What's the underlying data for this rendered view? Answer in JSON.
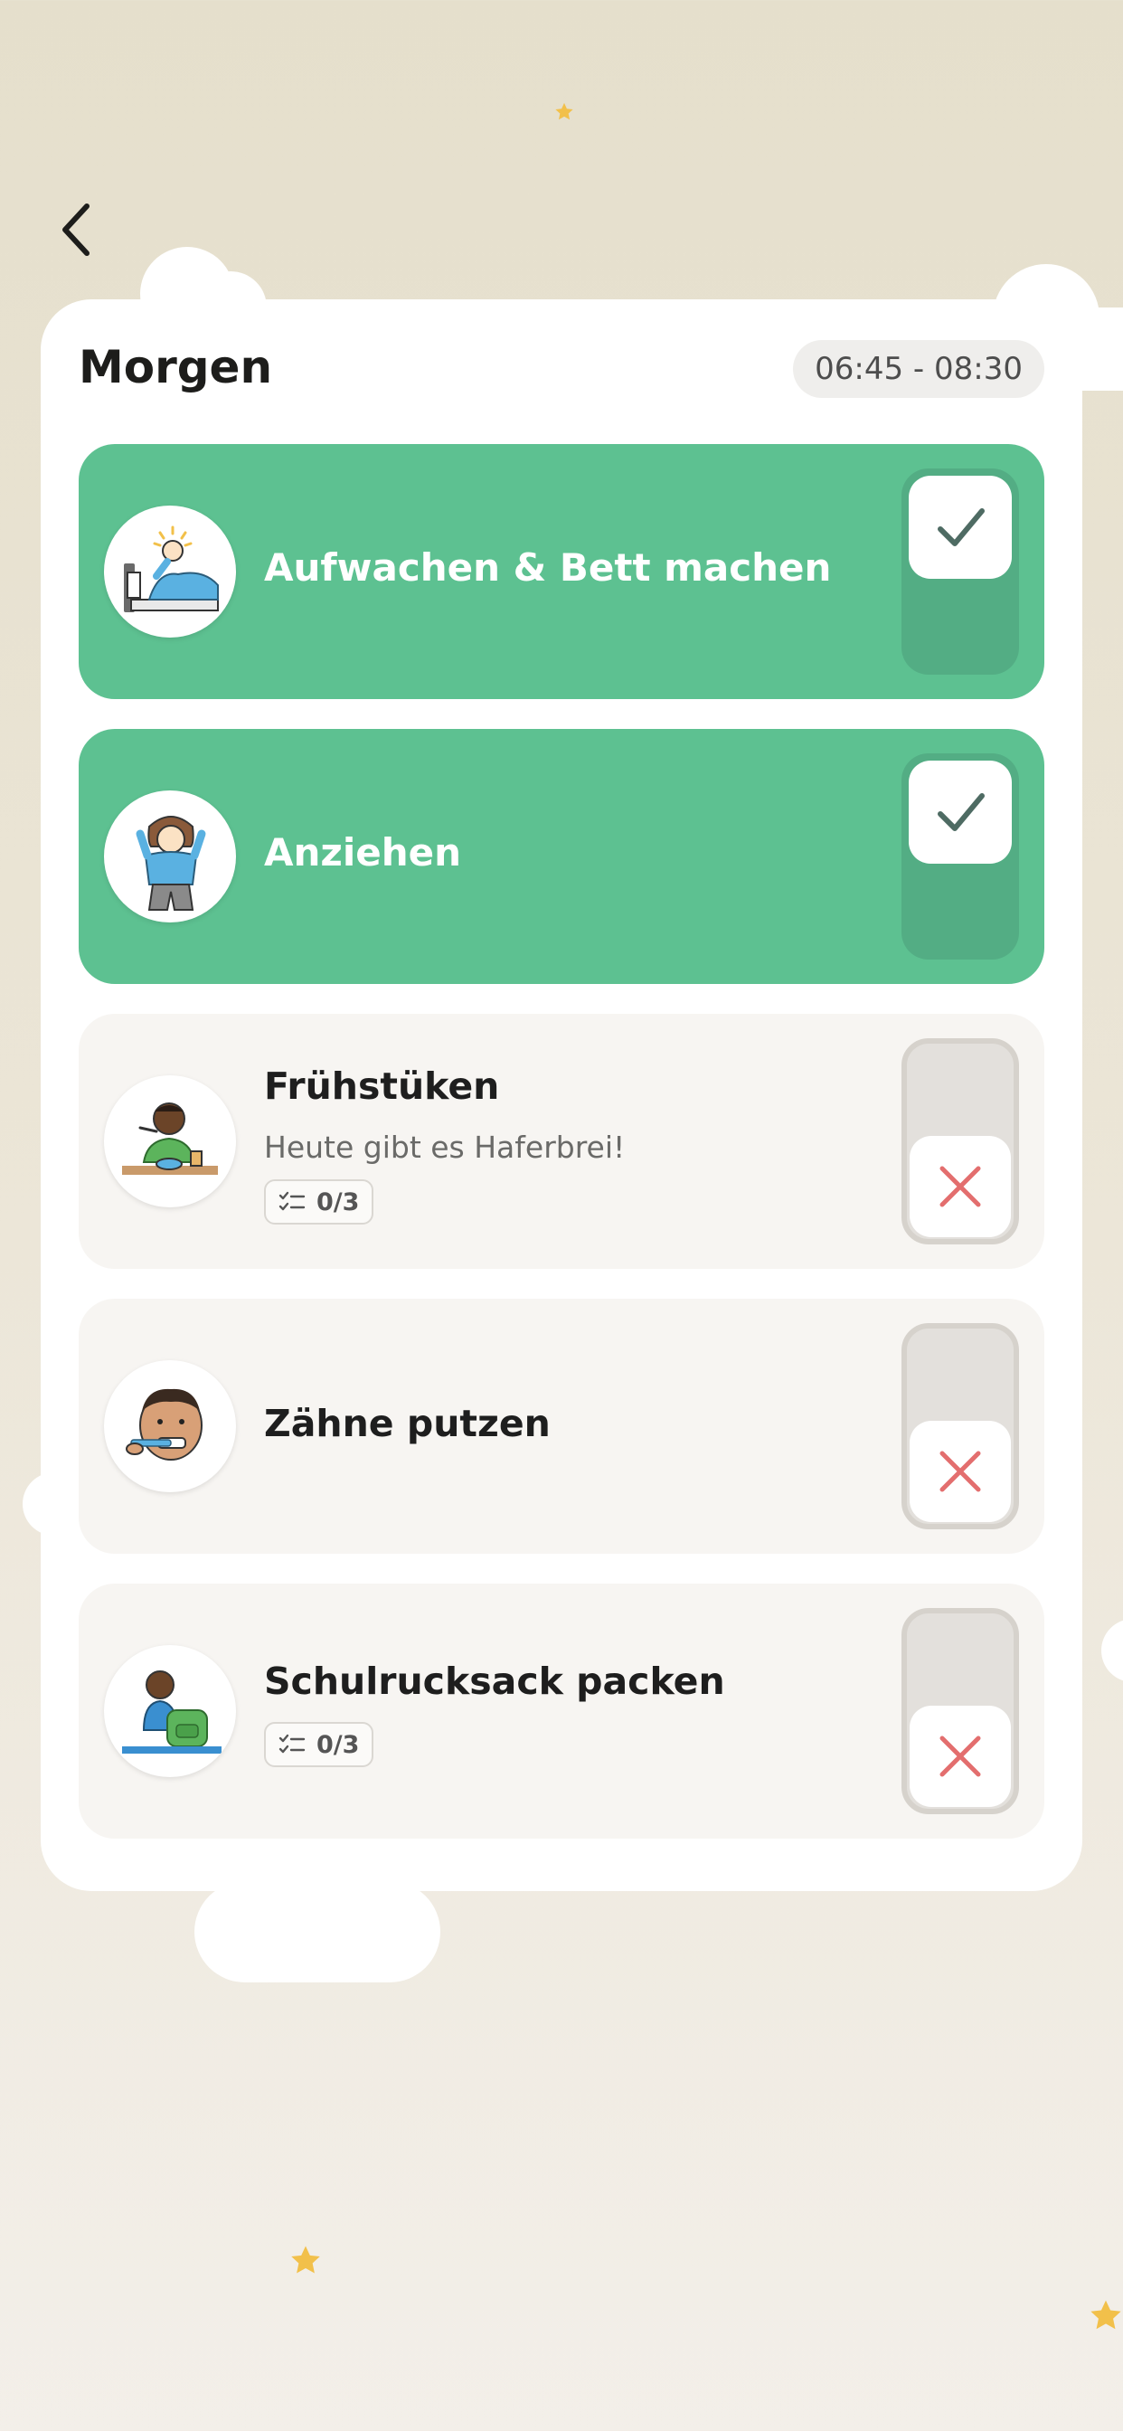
{
  "header": {
    "back_icon": "chevron-left-icon"
  },
  "routine": {
    "title": "Morgen",
    "time_range": "06:45 - 08:30"
  },
  "tasks": [
    {
      "title": "Aufwachen & Bett machen",
      "completed": true,
      "icon": "wake-up-illustration"
    },
    {
      "title": "Anziehen",
      "completed": true,
      "icon": "getting-dressed-illustration"
    },
    {
      "title": "Frühstüken",
      "subtitle": "Heute gibt es Haferbrei!",
      "checklist": "0/3",
      "completed": false,
      "icon": "breakfast-illustration"
    },
    {
      "title": "Zähne putzen",
      "completed": false,
      "icon": "brushing-teeth-illustration"
    },
    {
      "title": "Schulrucksack packen",
      "checklist": "0/3",
      "completed": false,
      "icon": "backpack-illustration"
    }
  ],
  "colors": {
    "done_card": "#5dc191",
    "done_toggle": "#53ad84",
    "open_card": "#f7f5f2",
    "check_mark": "#4e6b63",
    "cross_mark": "#e36e6e",
    "star": "#f2c04a"
  }
}
